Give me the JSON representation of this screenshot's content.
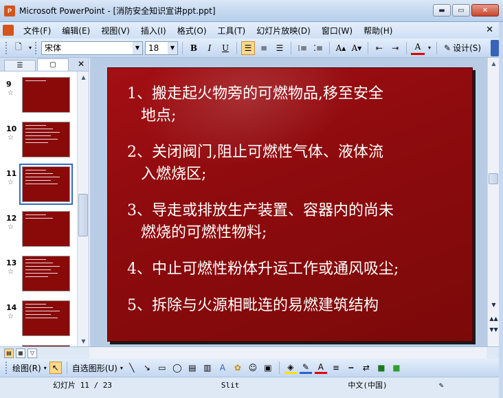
{
  "window": {
    "app_icon_letter": "P",
    "title": "Microsoft PowerPoint - [消防安全知识宣讲ppt.ppt]",
    "minimize": "▬",
    "maximize": "▭",
    "close": "✕"
  },
  "menu": {
    "items": [
      "文件(F)",
      "编辑(E)",
      "视图(V)",
      "插入(I)",
      "格式(O)",
      "工具(T)",
      "幻灯片放映(D)",
      "窗口(W)",
      "帮助(H)"
    ],
    "close": "✕"
  },
  "toolbar": {
    "font_name": "宋体",
    "font_size": "18",
    "bold": "B",
    "italic": "I",
    "underline": "U",
    "design_label": "设计(S)"
  },
  "left_pane": {
    "tab_outline_icon": "☰",
    "tab_slides_icon": "▢",
    "close": "✕",
    "thumbnails": [
      {
        "num": "9",
        "lines": 1,
        "selected": false
      },
      {
        "num": "10",
        "lines": 6,
        "selected": false
      },
      {
        "num": "11",
        "lines": 5,
        "selected": true
      },
      {
        "num": "12",
        "lines": 2,
        "selected": false
      },
      {
        "num": "13",
        "lines": 6,
        "selected": false
      },
      {
        "num": "14",
        "lines": 5,
        "selected": false
      },
      {
        "num": "",
        "lines": 0,
        "selected": false
      }
    ]
  },
  "slide": {
    "bullets": [
      {
        "line1": "1、搬走起火物旁的可燃物品,移至安全",
        "line2": "地点;"
      },
      {
        "line1": "2、关闭阀门,阻止可燃性气体、液体流",
        "line2": "入燃烧区;"
      },
      {
        "line1": "3、导走或排放生产装置、容器内的尚未",
        "line2": "燃烧的可燃性物料;"
      },
      {
        "line1": "4、中止可燃性粉体升运工作或通风吸尘;",
        "line2": ""
      },
      {
        "line1": "5、拆除与火源相毗连的易燃建筑结构",
        "line2": ""
      }
    ]
  },
  "drawbar": {
    "draw_label": "绘图(R)",
    "autoshape_label": "自选图形(U)"
  },
  "status": {
    "slide_position": "幻灯片 11 / 23",
    "design": "Slit",
    "language": "中文(中国)"
  }
}
